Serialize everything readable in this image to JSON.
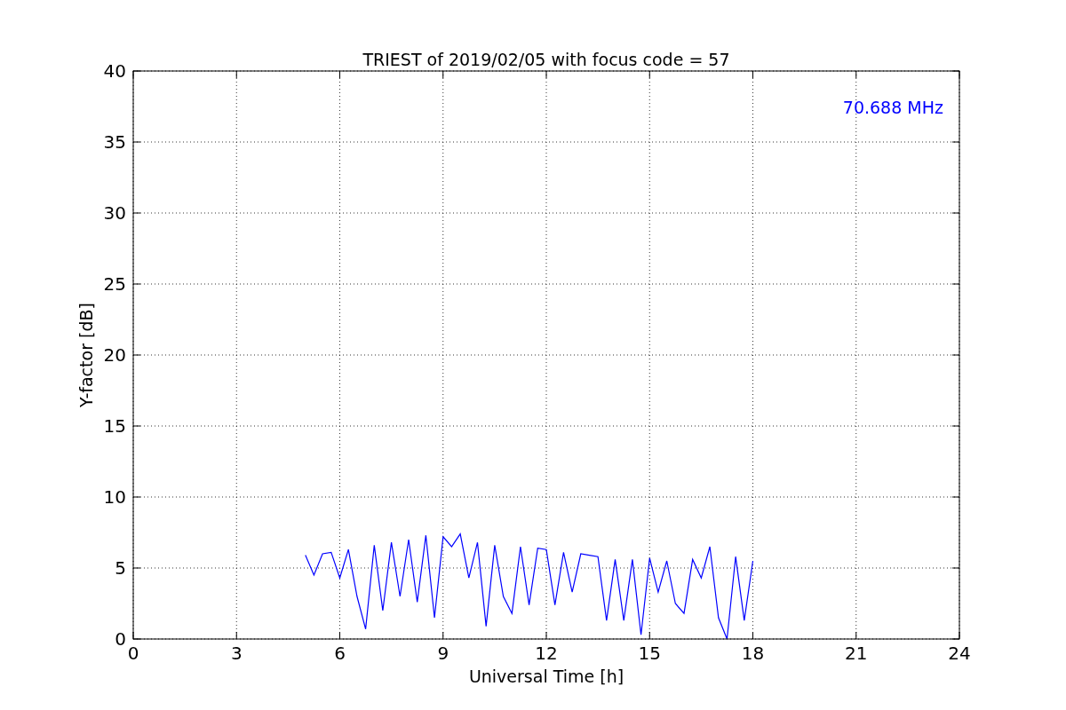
{
  "chart_data": {
    "type": "line",
    "title": "TRIEST of 2019/02/05 with focus code = 57",
    "xlabel": "Universal Time [h]",
    "ylabel": "Y-factor [dB]",
    "x": [
      5,
      5.25,
      5.5,
      5.75,
      6,
      6.25,
      6.5,
      6.75,
      7,
      7.25,
      7.5,
      7.75,
      8,
      8.25,
      8.5,
      8.75,
      9,
      9.25,
      9.5,
      9.75,
      10,
      10.25,
      10.5,
      10.75,
      11,
      11.25,
      11.5,
      11.75,
      12,
      12.25,
      12.5,
      12.75,
      13,
      13.25,
      13.5,
      13.75,
      14,
      14.25,
      14.5,
      14.75,
      15,
      15.25,
      15.5,
      15.75,
      16,
      16.25,
      16.5,
      16.75,
      17,
      17.25,
      17.5,
      17.75,
      18
    ],
    "series": [
      {
        "color": "#0000ff",
        "values": [
          5.9,
          4.5,
          6.0,
          6.1,
          4.3,
          6.3,
          3.0,
          0.7,
          6.6,
          2.0,
          6.8,
          3.0,
          7.0,
          2.6,
          7.3,
          1.5,
          7.2,
          6.5,
          7.4,
          4.3,
          6.8,
          0.9,
          6.6,
          3.0,
          1.8,
          6.5,
          2.4,
          6.4,
          6.3,
          2.4,
          6.1,
          3.3,
          6.0,
          5.9,
          5.8,
          1.3,
          5.6,
          1.3,
          5.6,
          0.3,
          5.7,
          3.3,
          5.5,
          2.5,
          1.8,
          5.6,
          4.3,
          6.5,
          1.5,
          0.0,
          5.8,
          1.3,
          5.5
        ]
      }
    ],
    "xlim": [
      0,
      24
    ],
    "ylim": [
      0,
      40
    ],
    "xticks": [
      0,
      3,
      6,
      9,
      12,
      15,
      18,
      21,
      24
    ],
    "yticks": [
      0,
      5,
      10,
      15,
      20,
      25,
      30,
      35,
      40
    ],
    "grid": true,
    "annotations": [
      "70.688 MHz"
    ]
  }
}
